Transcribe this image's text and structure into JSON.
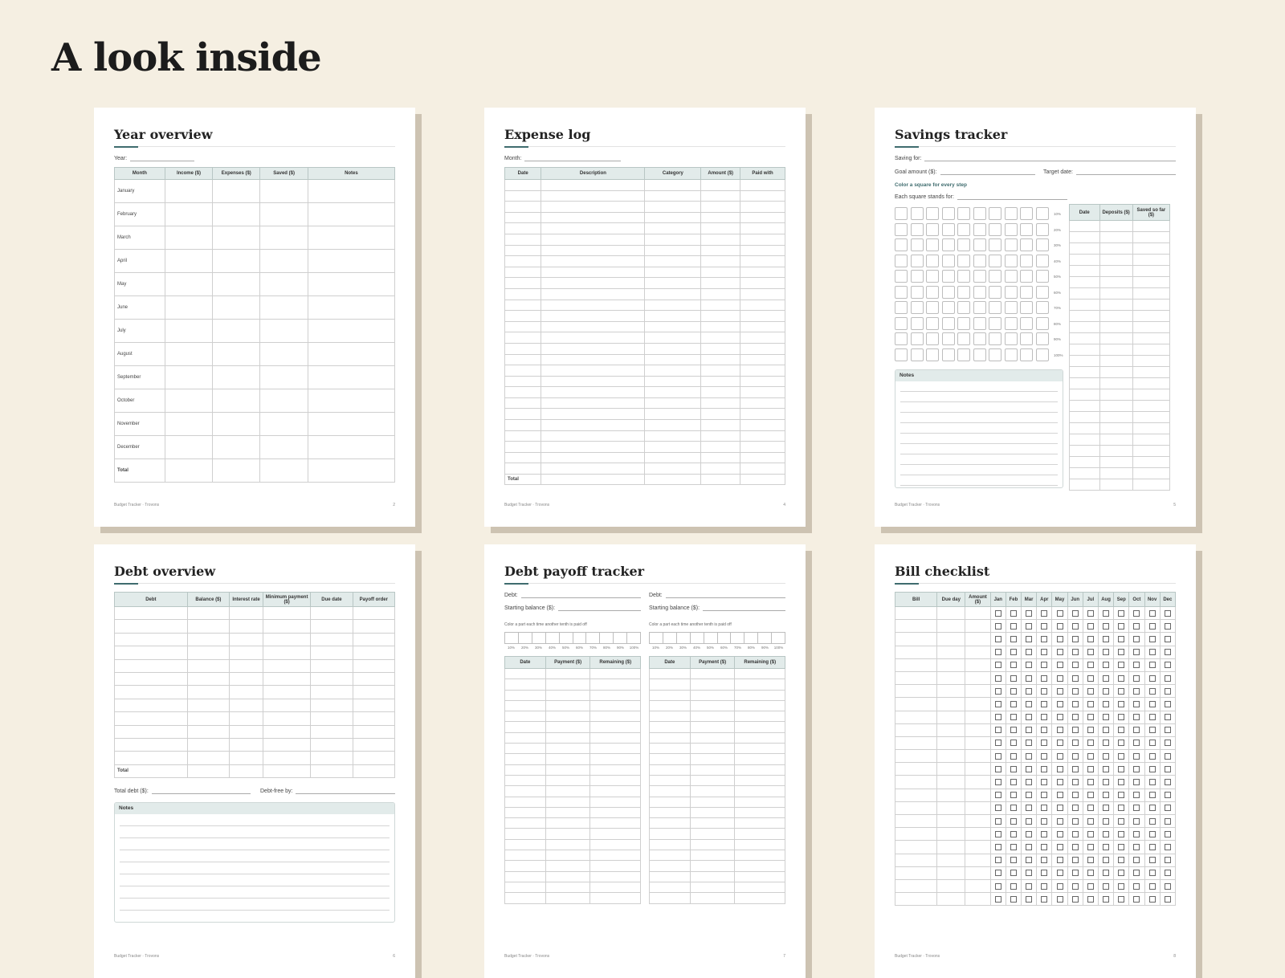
{
  "headline": "A look inside",
  "footer_brand": "Budget Tracker · Trovons",
  "year_overview": {
    "title": "Year overview",
    "year_label": "Year:",
    "columns": [
      "Month",
      "Income ($)",
      "Expenses ($)",
      "Saved ($)",
      "Notes"
    ],
    "rows": [
      "January",
      "February",
      "March",
      "April",
      "May",
      "June",
      "July",
      "August",
      "September",
      "October",
      "November",
      "December",
      "Total"
    ],
    "page_number": "2"
  },
  "expense_log": {
    "title": "Expense log",
    "month_label": "Month:",
    "columns": [
      "Date",
      "Description",
      "Category",
      "Amount ($)",
      "Paid with"
    ],
    "total_label": "Total",
    "page_number": "4"
  },
  "savings_tracker": {
    "title": "Savings tracker",
    "saving_for_label": "Saving for:",
    "goal_label": "Goal amount ($):",
    "target_label": "Target date:",
    "color_instruction": "Color a square for every step",
    "each_square_label": "Each square stands for:",
    "percent_labels": [
      "10%",
      "20%",
      "30%",
      "40%",
      "50%",
      "60%",
      "70%",
      "80%",
      "90%",
      "100%"
    ],
    "columns": [
      "Date",
      "Deposits ($)",
      "Saved so far ($)"
    ],
    "notes_label": "Notes",
    "page_number": "5"
  },
  "debt_overview": {
    "title": "Debt overview",
    "columns": [
      "Debt",
      "Balance ($)",
      "Interest rate",
      "Minimum payment ($)",
      "Due date",
      "Payoff order"
    ],
    "total_label": "Total",
    "total_debt_label": "Total debt ($):",
    "debt_free_label": "Debt-free by:",
    "notes_label": "Notes",
    "page_number": "6"
  },
  "debt_payoff": {
    "title": "Debt payoff tracker",
    "debt_label": "Debt:",
    "starting_label": "Starting balance ($):",
    "instruction": "Color a part each time another tenth is paid off",
    "percent_labels": [
      "10%",
      "20%",
      "30%",
      "40%",
      "50%",
      "60%",
      "70%",
      "80%",
      "90%",
      "100%"
    ],
    "columns": [
      "Date",
      "Payment ($)",
      "Remaining ($)"
    ],
    "page_number": "7"
  },
  "bill_checklist": {
    "title": "Bill checklist",
    "columns": [
      "Bill",
      "Due day",
      "Amount ($)"
    ],
    "months": [
      "Jan",
      "Feb",
      "Mar",
      "Apr",
      "May",
      "Jun",
      "Jul",
      "Aug",
      "Sep",
      "Oct",
      "Nov",
      "Dec"
    ],
    "page_number": "8"
  },
  "colors": {
    "background": "#f5efe2",
    "header_fill": "#e2ebea",
    "accent": "#3f6c6e",
    "shadow": "#cdc3b2"
  }
}
